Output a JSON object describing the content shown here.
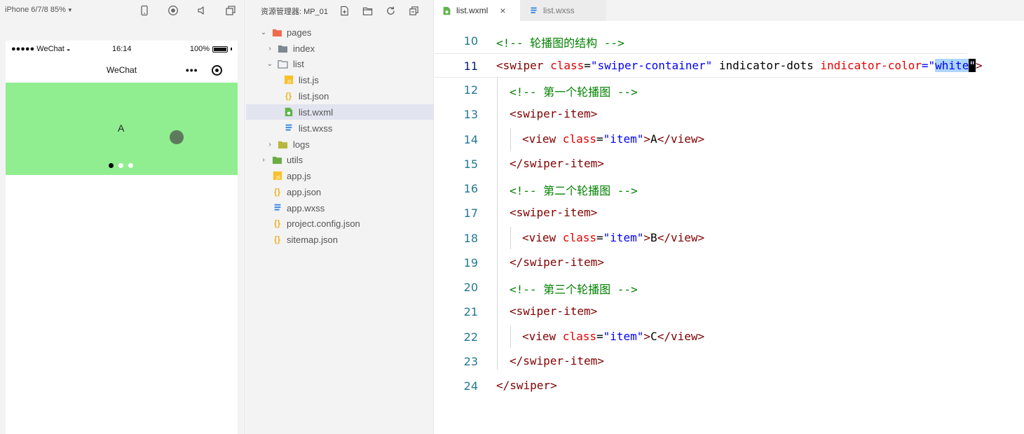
{
  "simulator": {
    "device_label": "iPhone 6/7/8 85%",
    "status": {
      "carrier": "●●●●● WeChat",
      "time": "16:14",
      "battery": "100%"
    },
    "nav_title": "WeChat",
    "swiper": {
      "current_item": "A",
      "indicator_count": 3,
      "active_index": 0,
      "background": "#90ee90"
    }
  },
  "explorer": {
    "title": "资源管理器: MP_01",
    "tree": [
      {
        "label": "pages",
        "type": "folder",
        "expanded": true
      },
      {
        "label": "index",
        "type": "folder",
        "expanded": false
      },
      {
        "label": "list",
        "type": "folder",
        "expanded": true
      },
      {
        "label": "list.js",
        "type": "js"
      },
      {
        "label": "list.json",
        "type": "json"
      },
      {
        "label": "list.wxml",
        "type": "wxml",
        "selected": true
      },
      {
        "label": "list.wxss",
        "type": "wxss"
      },
      {
        "label": "logs",
        "type": "folder",
        "expanded": false
      },
      {
        "label": "utils",
        "type": "folder",
        "expanded": false
      },
      {
        "label": "app.js",
        "type": "js"
      },
      {
        "label": "app.json",
        "type": "json"
      },
      {
        "label": "app.wxss",
        "type": "wxss"
      },
      {
        "label": "project.config.json",
        "type": "json"
      },
      {
        "label": "sitemap.json",
        "type": "json"
      }
    ]
  },
  "editor": {
    "tabs": [
      {
        "label": "list.wxml",
        "active": true,
        "close": "×"
      },
      {
        "label": "list.wxss",
        "active": false
      }
    ],
    "lines": [
      {
        "n": "10",
        "segs": {
          "a": "<!-- 轮播图的结构 -->"
        }
      },
      {
        "n": "11",
        "segs": {
          "a": "<swiper",
          "b": " class",
          "c": "=",
          "d": "\"swiper-container\"",
          "e": " indicator-dots",
          "f": " indicator-color",
          "g": "=\"",
          "h": "white",
          "i": "\"",
          "j": ">"
        }
      },
      {
        "n": "12",
        "segs": {
          "a": "<!-- 第一个轮播图 -->"
        }
      },
      {
        "n": "13",
        "segs": {
          "a": "<swiper-item>"
        }
      },
      {
        "n": "14",
        "segs": {
          "a": "<view",
          "b": " class",
          "c": "=",
          "d": "\"item\"",
          "e": ">",
          "f": "A",
          "g": "</view>"
        }
      },
      {
        "n": "15",
        "segs": {
          "a": "</swiper-item>"
        }
      },
      {
        "n": "16",
        "segs": {
          "a": "<!-- 第二个轮播图 -->"
        }
      },
      {
        "n": "17",
        "segs": {
          "a": "<swiper-item>"
        }
      },
      {
        "n": "18",
        "segs": {
          "a": "<view",
          "b": " class",
          "c": "=",
          "d": "\"item\"",
          "e": ">",
          "f": "B",
          "g": "</view>"
        }
      },
      {
        "n": "19",
        "segs": {
          "a": "</swiper-item>"
        }
      },
      {
        "n": "20",
        "segs": {
          "a": "<!-- 第三个轮播图 -->"
        }
      },
      {
        "n": "21",
        "segs": {
          "a": "<swiper-item>"
        }
      },
      {
        "n": "22",
        "segs": {
          "a": "<view",
          "b": " class",
          "c": "=",
          "d": "\"item\"",
          "e": ">",
          "f": "C",
          "g": "</view>"
        }
      },
      {
        "n": "23",
        "segs": {
          "a": "</swiper-item>"
        }
      },
      {
        "n": "24",
        "segs": {
          "a": "</swiper>"
        }
      }
    ]
  },
  "colors": {
    "comment": "#008000",
    "tag": "#800000",
    "attribute": "#e50000",
    "string": "#0000ff",
    "line_number": "#237893",
    "selection": "#add6ff",
    "swiper_bg": "#90ee90"
  }
}
